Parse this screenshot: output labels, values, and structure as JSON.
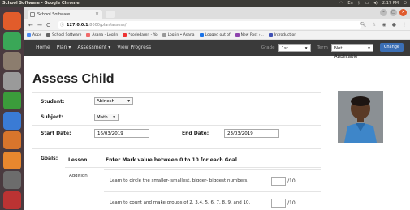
{
  "os": {
    "window_title": "School Software - Google Chrome",
    "time": "2:17 PM"
  },
  "launcher": [
    {
      "name": "ubuntu-dash-icon",
      "color": "#e25c2b"
    },
    {
      "name": "chrome-icon",
      "color": "#3aa757"
    },
    {
      "name": "files-icon",
      "color": "#8c7d6e"
    },
    {
      "name": "settings-icon",
      "color": "#9a9a9a"
    },
    {
      "name": "spreadsheet-icon",
      "color": "#3b9c3b"
    },
    {
      "name": "document-icon",
      "color": "#3a7bd5"
    },
    {
      "name": "presentation-icon",
      "color": "#d8752c"
    },
    {
      "name": "app-store-icon",
      "color": "#e8872e"
    },
    {
      "name": "terminal-icon",
      "color": "#6c6c6c"
    },
    {
      "name": "trash-icon",
      "color": "#b33"
    }
  ],
  "browser": {
    "tab_title": "School Software",
    "url_host": "127.0.0.1",
    "url_path": ":8000/plan/assess/",
    "bookmarks": [
      {
        "label": "Apps",
        "color": "#4c8bf5"
      },
      {
        "label": "School Software",
        "color": "#666"
      },
      {
        "label": "Asana - Log In",
        "color": "#f06a6a"
      },
      {
        "label": "*codedamn - Yo",
        "color": "#e33"
      },
      {
        "label": "Log in • Asana",
        "color": "#999"
      },
      {
        "label": "Logged out of",
        "color": "#1a73e8"
      },
      {
        "label": "New Post › ..",
        "color": "#8e44ad"
      },
      {
        "label": "Introduction",
        "color": "#3f51b5"
      }
    ]
  },
  "navbar": {
    "menu": [
      "Home",
      "Plan ▾",
      "Assessment ▾",
      "View Progress"
    ],
    "grade_label": "Grade",
    "grade_value": "1st",
    "term_label": "Term",
    "term_value": "Not Applicable",
    "change_label": "Change"
  },
  "page": {
    "title": "Assess Child",
    "student_label": "Student:",
    "student_value": "Abinesh",
    "subject_label": "Subject:",
    "subject_value": "Math",
    "start_label": "Start Date:",
    "start_value": "16/03/2019",
    "end_label": "End Date:",
    "end_value": "23/03/2019",
    "goals_label": "Goals:",
    "lesson_header": "Lesson",
    "instruction": "Enter Mark value between 0 to 10 for each Goal",
    "lesson_name": "Addition",
    "goals": [
      {
        "text": "Learn to circle the smaller- smallest, bigger- biggest numbers.",
        "suffix": "/10"
      },
      {
        "text": "Learn to count and make groups of 2, 3,4, 5, 6, 7, 8, 9, and 10.",
        "suffix": "/10"
      }
    ]
  }
}
